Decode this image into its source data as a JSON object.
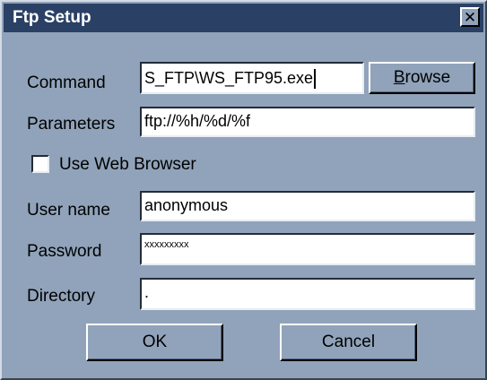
{
  "window": {
    "title": "Ftp Setup",
    "close_glyph": "✕"
  },
  "fields": {
    "command": {
      "label": "Command",
      "value": "S_FTP\\WS_FTP95.exe"
    },
    "parameters": {
      "label": "Parameters",
      "value": "ftp://%h/%d/%f"
    },
    "username": {
      "label": "User name",
      "value": "anonymous"
    },
    "password": {
      "label": "Password",
      "value": "xxxxxxxxx"
    },
    "directory": {
      "label": "Directory",
      "value": "."
    }
  },
  "checkbox": {
    "label": "Use Web Browser",
    "checked": false
  },
  "buttons": {
    "browse_first": "B",
    "browse_rest": "rowse",
    "ok": "OK",
    "cancel": "Cancel"
  },
  "colors": {
    "dialog_bg": "#90a3ba",
    "titlebar_bg": "#2a4165",
    "title_text": "#ffffff"
  },
  "icons": {
    "close": "close-icon"
  }
}
